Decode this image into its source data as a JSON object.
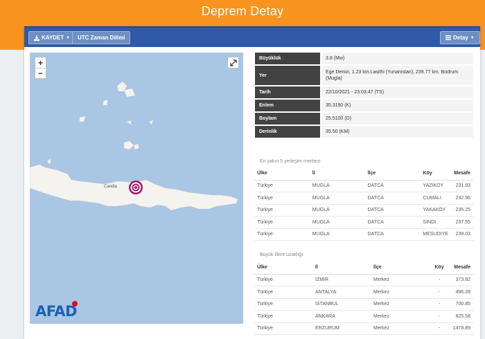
{
  "page": {
    "title": "Deprem Detay"
  },
  "toolbar": {
    "save_label": "KAYDET",
    "timezone_label": "UTC Zaman Dilimi",
    "detail_label": "Detay"
  },
  "map": {
    "zoom_in": "+",
    "zoom_out": "−",
    "city_label": "Candia",
    "logo_text": "AFAD"
  },
  "details": [
    {
      "key": "Büyüklük",
      "value": "3.8 (Mw)"
    },
    {
      "key": "Yer",
      "value": "Ege Denizi, 1.23 km.Lasithi (Yunanistan), 239.77 km. Bodrum (Mugla)"
    },
    {
      "key": "Tarih",
      "value": "22/10/2021 - 23:03:47 (TS)"
    },
    {
      "key": "Enlem",
      "value": "35.3190 (K)"
    },
    {
      "key": "Boylam",
      "value": "25.5100 (D)"
    },
    {
      "key": "Derinlik",
      "value": "35.50 (KM)"
    }
  ],
  "nearest": {
    "title": "En yakın 5 yerleşim merkezi",
    "headers": [
      "Ülke",
      "İl",
      "İlçe",
      "Köy",
      "Mesafe"
    ],
    "rows": [
      [
        "Türkiye",
        "MUGLA",
        "DATCA",
        "YAZIKOY",
        "231.93"
      ],
      [
        "Türkiye",
        "MUGLA",
        "DATCA",
        "CUMALI",
        "232.96"
      ],
      [
        "Türkiye",
        "MUGLA",
        "DATCA",
        "YAKAKOY",
        "235.25"
      ],
      [
        "Türkiye",
        "MUGLA",
        "DATCA",
        "SINDI",
        "237.55"
      ],
      [
        "Türkiye",
        "MUGLA",
        "DATCA",
        "MESUDIYE",
        "239.03"
      ]
    ]
  },
  "cities": {
    "title": "Büyük illere uzaklığı",
    "headers": [
      "Ülke",
      "İl",
      "İlçe",
      "Köy",
      "Mesafe"
    ],
    "rows": [
      [
        "Türkiye",
        "IZMIR",
        "Merkez",
        "-",
        "373.92"
      ],
      [
        "Türkiye",
        "ANTALYA",
        "Merkez",
        "-",
        "496.39"
      ],
      [
        "Türkiye",
        "ISTANBUL",
        "Merkez",
        "-",
        "700.85"
      ],
      [
        "Türkiye",
        "ANKARA",
        "Merkez",
        "-",
        "825.58"
      ],
      [
        "Türkiye",
        "ERZURUM",
        "Merkez",
        "-",
        "1478.89"
      ]
    ]
  },
  "colors": {
    "header": "#f7931e",
    "toolbar": "#2e5aa6",
    "sea": "#a9c6e4",
    "land": "#f4f3ef",
    "epicenter": "#a0166b"
  }
}
